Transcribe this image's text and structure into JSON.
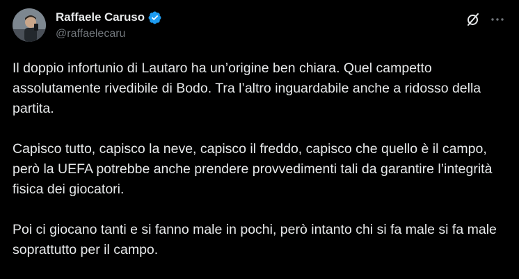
{
  "author": {
    "display_name": "Raffaele Caruso",
    "handle": "@raffaelecaru",
    "verified": true
  },
  "colors": {
    "background": "#000000",
    "text": "#e7e9ea",
    "muted": "#71767b",
    "verified_badge": "#1d9bf0"
  },
  "actions": {
    "grok_icon": "grok-icon",
    "more_icon": "more-icon"
  },
  "tweet": {
    "paragraphs": [
      "Il doppio infortunio di Lautaro ha un’origine ben chiara. Quel campetto assolutamente rivedibile di Bodo. Tra l’altro inguardabile anche a ridosso della partita.",
      "Capisco tutto, capisco la neve, capisco il freddo, capisco che quello è il campo, però la UEFA potrebbe anche prendere provvedimenti tali da garantire l’integrità fisica dei giocatori.",
      "Poi ci giocano tanti e si fanno male in pochi, però intanto chi si fa male si fa male soprattutto per il campo."
    ]
  }
}
